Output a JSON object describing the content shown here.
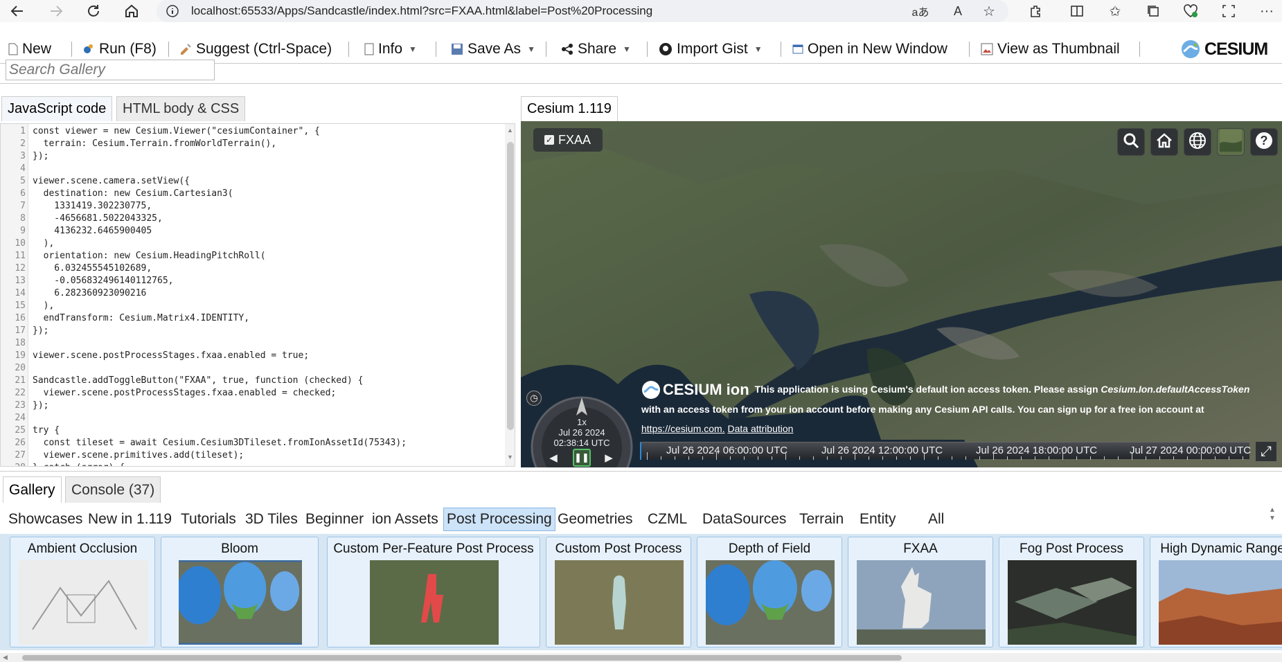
{
  "browser": {
    "url": "localhost:65533/Apps/Sandcastle/index.html?src=FXAA.html&label=Post%20Processing"
  },
  "toolbar": {
    "new": "New",
    "run": "Run (F8)",
    "suggest": "Suggest (Ctrl-Space)",
    "info": "Info",
    "save_as": "Save As",
    "share": "Share",
    "import_gist": "Import Gist",
    "open_new_window": "Open in New Window",
    "view_thumbnail": "View as Thumbnail",
    "logo": "CESIUM"
  },
  "search": {
    "placeholder": "Search Gallery"
  },
  "editor_tabs": {
    "js": "JavaScript code",
    "html": "HTML body & CSS"
  },
  "viewer_tab": "Cesium 1.119",
  "code_lines": [
    "const viewer = new Cesium.Viewer(\"cesiumContainer\", {",
    "  terrain: Cesium.Terrain.fromWorldTerrain(),",
    "});",
    "",
    "viewer.scene.camera.setView({",
    "  destination: new Cesium.Cartesian3(",
    "    1331419.302230775,",
    "    -4656681.5022043325,",
    "    4136232.6465900405",
    "  ),",
    "  orientation: new Cesium.HeadingPitchRoll(",
    "    6.032455545102689,",
    "    -0.056832496140112765,",
    "    6.282360923090216",
    "  ),",
    "  endTransform: Cesium.Matrix4.IDENTITY,",
    "});",
    "",
    "viewer.scene.postProcessStages.fxaa.enabled = true;",
    "",
    "Sandcastle.addToggleButton(\"FXAA\", true, function (checked) {",
    "  viewer.scene.postProcessStages.fxaa.enabled = checked;",
    "});",
    "",
    "try {",
    "  const tileset = await Cesium.Cesium3DTileset.fromIonAssetId(75343);",
    "  viewer.scene.primitives.add(tileset);",
    "} catch (error) {"
  ],
  "viewer": {
    "toggle_label": "FXAA",
    "credit_logo": "CESIUM ion",
    "credit_text": "This application is using Cesium's default ion access token. Please assign",
    "credit_token": "Cesium.Ion.defaultAccessToken",
    "credit_text2": "with an access token from your ion account before making any Cesium API calls. You can sign up for a free ion account at",
    "credit_link": "https://cesium.com.",
    "credit_attr": "Data attribution",
    "anim_speed": "1x",
    "anim_date": "Jul 26 2024",
    "anim_time": "02:38:14 UTC",
    "timeline": [
      "Jul 26 2024 06:00:00 UTC",
      "Jul 26 2024 12:00:00 UTC",
      "Jul 26 2024 18:00:00 UTC",
      "Jul 27 2024 00:00:00 UTC"
    ]
  },
  "gallery_tabs": {
    "gallery": "Gallery",
    "console": "Console (37)"
  },
  "categories": [
    "Showcases",
    "New in 1.119",
    "Tutorials",
    "3D Tiles",
    "Beginner",
    "ion Assets",
    "Post Processing",
    "Geometries",
    "CZML",
    "DataSources",
    "Terrain",
    "Entity",
    "All"
  ],
  "selected_category": "Post Processing",
  "demos": [
    "Ambient Occlusion",
    "Bloom",
    "Custom Per-Feature Post Process",
    "Custom Post Process",
    "Depth of Field",
    "FXAA",
    "Fog Post Process",
    "High Dynamic Range"
  ]
}
